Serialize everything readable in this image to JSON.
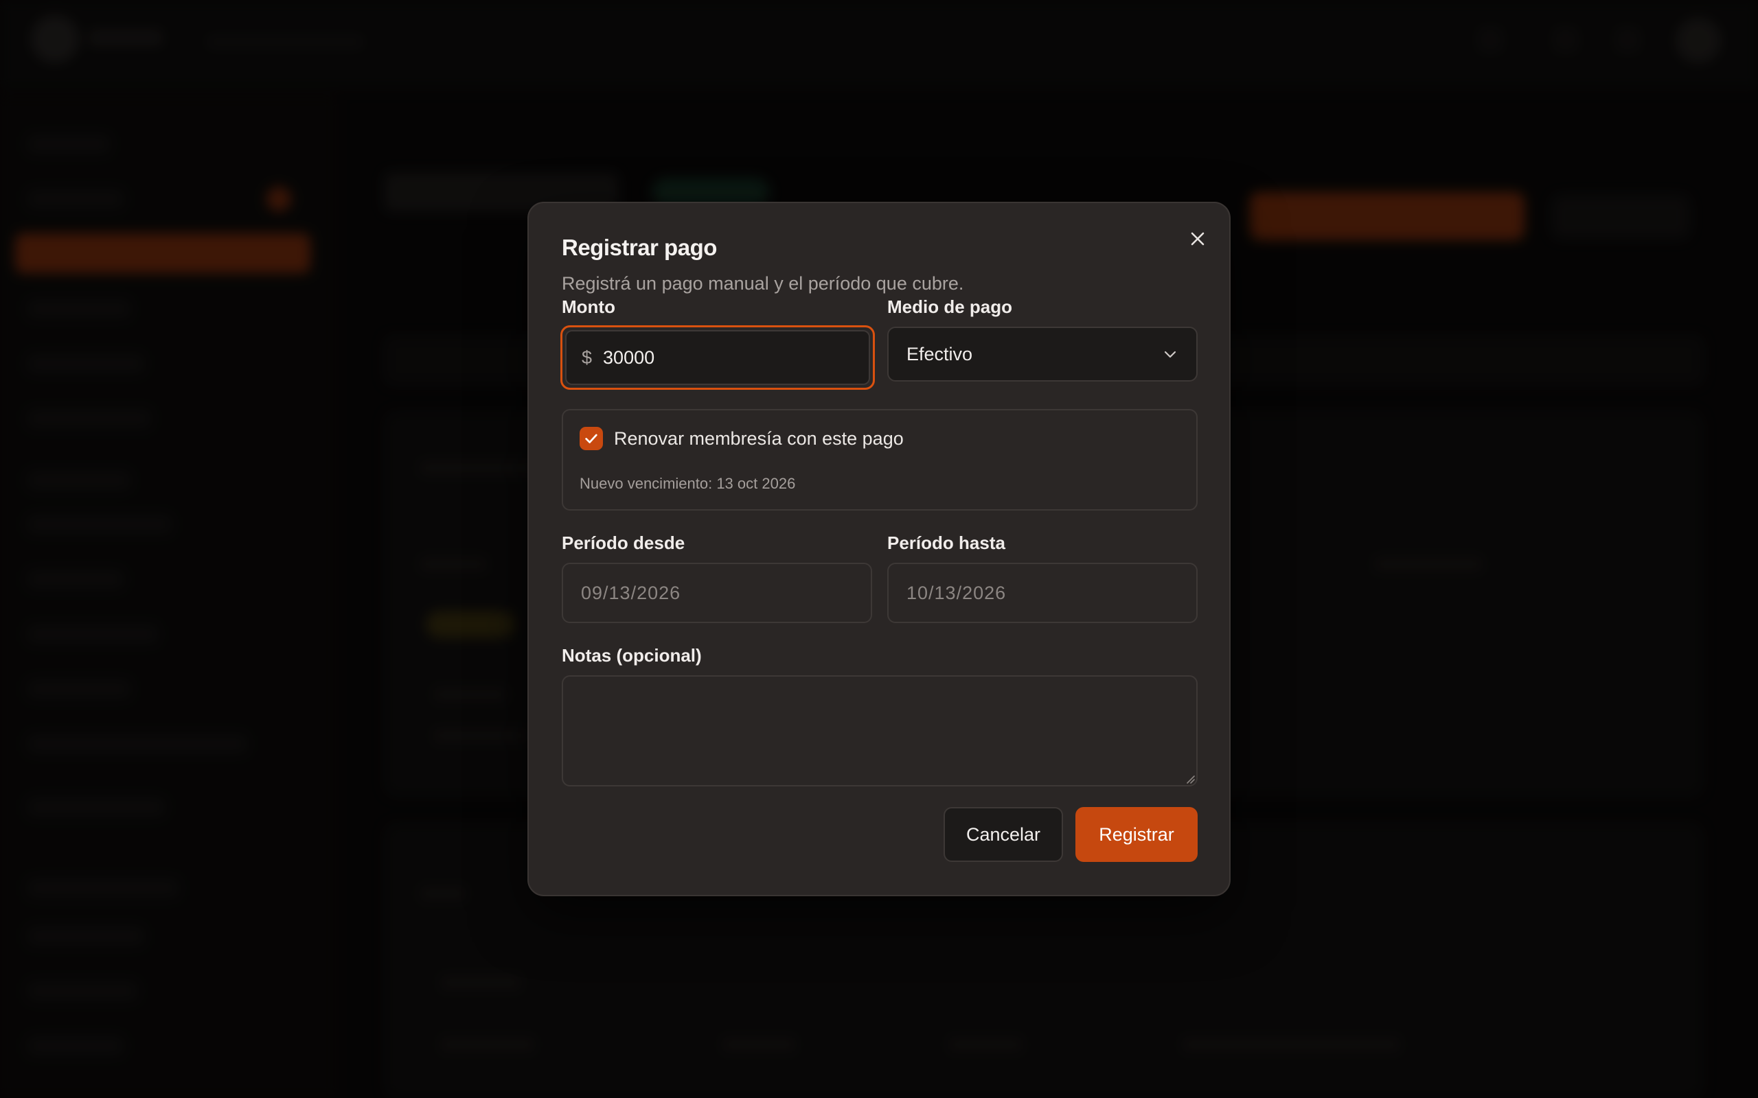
{
  "modal": {
    "title": "Registrar pago",
    "subtitle": "Registrá un pago manual y el período que cubre.",
    "close_icon": "close-icon",
    "amount": {
      "label": "Monto",
      "currency_symbol": "$",
      "value": "30000"
    },
    "payment_method": {
      "label": "Medio de pago",
      "selected": "Efectivo",
      "icon": "chevron-down-icon"
    },
    "renew": {
      "checked": true,
      "label": "Renovar membresía con este pago",
      "note": "Nuevo vencimiento: 13 oct 2026"
    },
    "period_from": {
      "label": "Período desde",
      "value": "09/13/2026"
    },
    "period_to": {
      "label": "Período hasta",
      "value": "10/13/2026"
    },
    "notes": {
      "label": "Notas (opcional)",
      "value": ""
    },
    "buttons": {
      "cancel": "Cancelar",
      "submit": "Registrar"
    }
  },
  "colors": {
    "accent": "#c6480f",
    "modal_bg": "#2a2625",
    "focus_ring": "#d9510f"
  }
}
